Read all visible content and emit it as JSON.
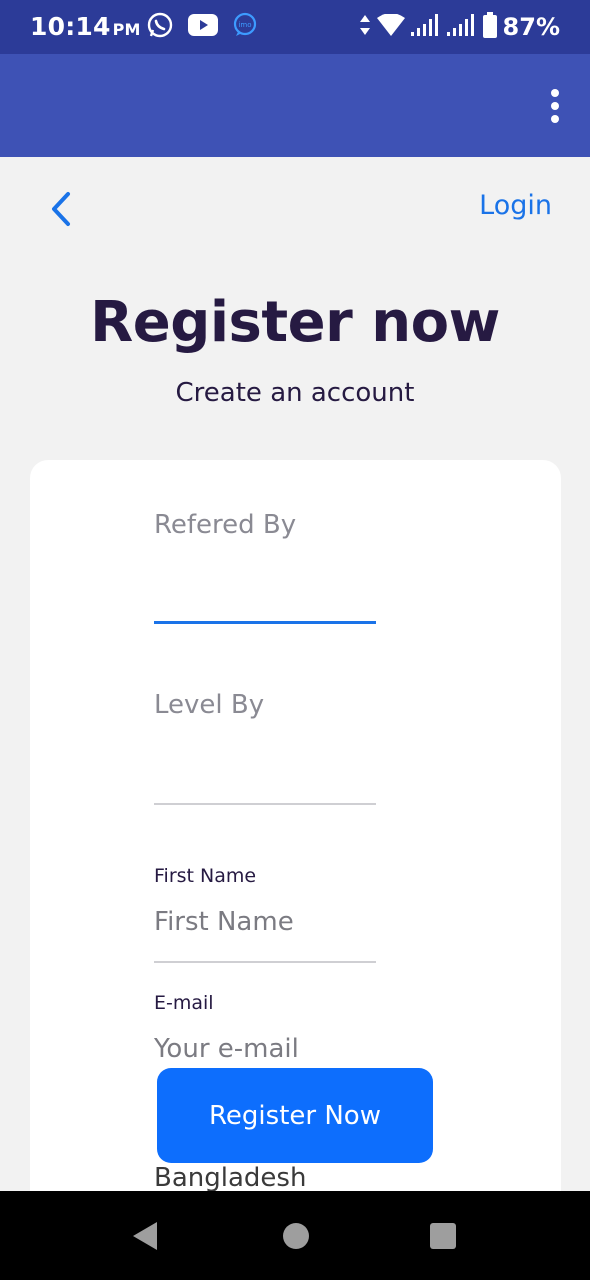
{
  "status_bar": {
    "time": "10:14",
    "ampm": "PM",
    "battery": "87%",
    "icons": [
      "whatsapp-icon",
      "youtube-icon",
      "imo-icon",
      "data-arrows-icon",
      "wifi-icon",
      "signal-icon",
      "signal-icon",
      "battery-icon"
    ]
  },
  "app_bar": {
    "menu_icon": "more-vert-icon"
  },
  "nav": {
    "back_icon": "chevron-left-icon",
    "login_label": "Login"
  },
  "header": {
    "title": "Register now",
    "subtitle": "Create an account"
  },
  "form": {
    "refered_by": {
      "placeholder": "Refered By",
      "value": ""
    },
    "level_by": {
      "placeholder": "Level By",
      "value": ""
    },
    "first_name": {
      "label": "First Name",
      "placeholder": "First Name",
      "value": ""
    },
    "email": {
      "label": "E-mail",
      "placeholder": "Your e-mail",
      "value": ""
    },
    "country": {
      "value": "Bangladesh"
    },
    "submit_label": "Register Now"
  },
  "colors": {
    "status_bar": "#2c3b98",
    "app_bar": "#3e52b5",
    "accent": "#1a73e8",
    "button": "#0d6efd",
    "title": "#261a42"
  },
  "system_nav": {
    "icons": [
      "back-triangle-icon",
      "home-circle-icon",
      "recents-square-icon"
    ]
  }
}
